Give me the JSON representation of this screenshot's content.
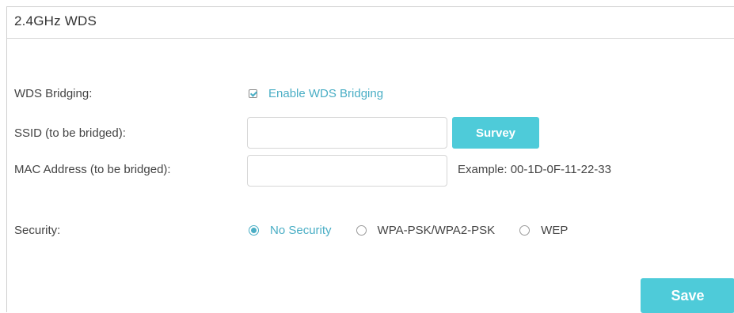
{
  "panel": {
    "title": "2.4GHz WDS"
  },
  "form": {
    "wds_bridging": {
      "label": "WDS Bridging:",
      "checkbox_label": "Enable WDS Bridging",
      "checked": true
    },
    "ssid": {
      "label": "SSID (to be bridged):",
      "value": "",
      "placeholder": "",
      "survey_label": "Survey"
    },
    "mac": {
      "label": "MAC Address (to be bridged):",
      "value": "",
      "placeholder": "",
      "example": "Example: 00-1D-0F-11-22-33"
    },
    "security": {
      "label": "Security:",
      "options": [
        "No Security",
        "WPA-PSK/WPA2-PSK",
        "WEP"
      ],
      "selected": "No Security"
    }
  },
  "actions": {
    "save_label": "Save"
  },
  "colors": {
    "accent": "#4aaec5",
    "button": "#4ecbd9",
    "label": "#444444"
  }
}
